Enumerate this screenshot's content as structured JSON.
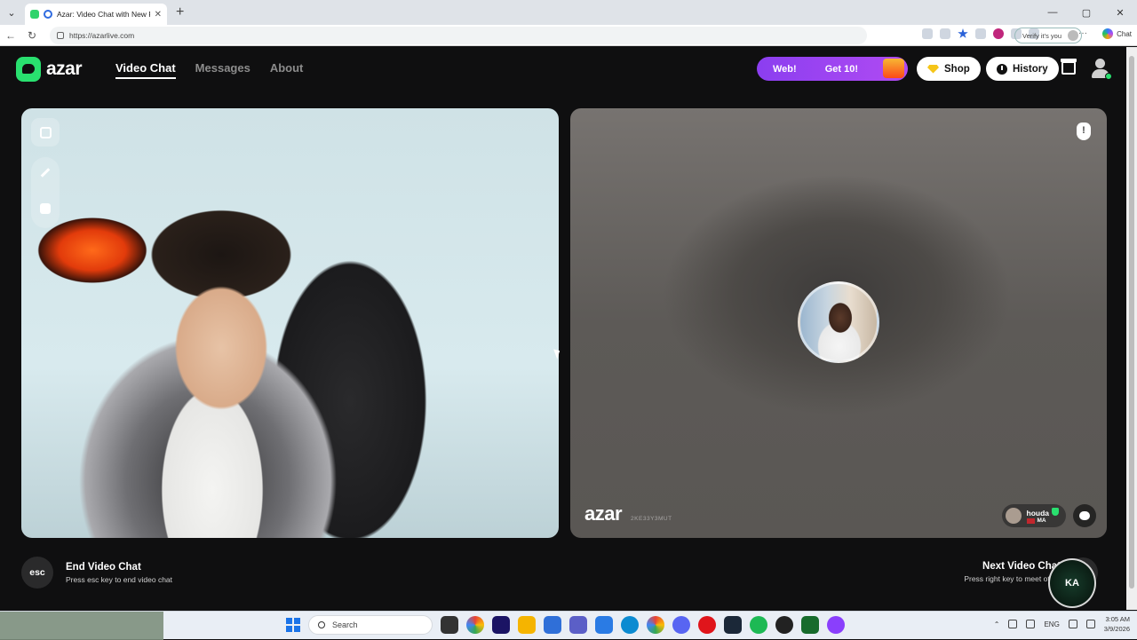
{
  "browser": {
    "tab_title": "Azar: Video Chat with New Pe",
    "url": "https://azarlive.com",
    "verify_label": "Verify it's you",
    "copilot_label": "Chat"
  },
  "header": {
    "logo_text": "azar",
    "nav": [
      {
        "label": "Video Chat",
        "active": true
      },
      {
        "label": "Messages",
        "active": false
      },
      {
        "label": "About",
        "active": false
      }
    ],
    "promo_left": "Web!",
    "promo_right": "Get 10!",
    "shop_label": "Shop",
    "history_label": "History"
  },
  "remote": {
    "watermark": "azar",
    "watermark_id": "2KE33Y3MUT",
    "peer_name": "houda",
    "peer_country": "MA"
  },
  "footer": {
    "esc_label": "esc",
    "end_title": "End Video Chat",
    "end_sub": "Press esc key to end video chat",
    "next_title": "Next Video Chat",
    "next_sub": "Press right key to meet other"
  },
  "taskbar": {
    "search_placeholder": "Search",
    "lang": "ENG",
    "time": "3:05 AM",
    "date": "3/9/2026"
  },
  "colors": {
    "brand_green": "#29e06f",
    "promo_purple": "#9a44f1",
    "background": "#0f0f10"
  }
}
